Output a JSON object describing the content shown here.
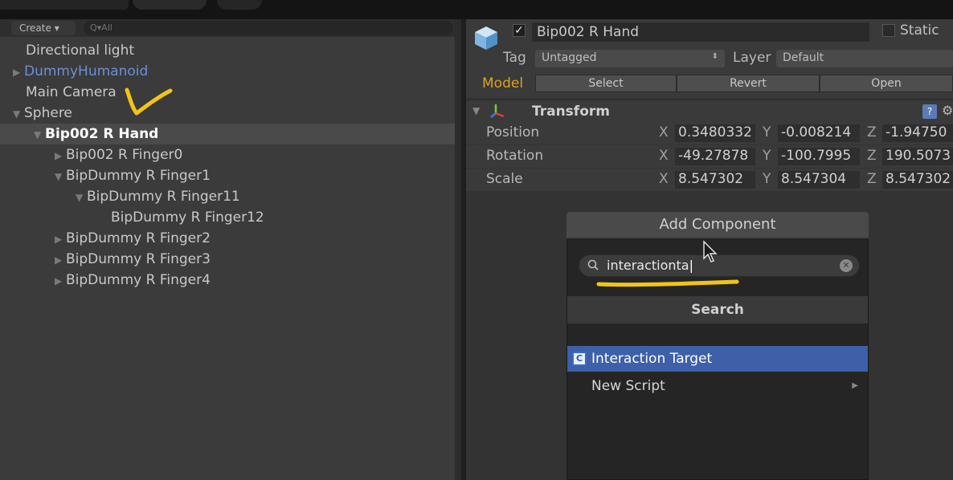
{
  "hierarchy": {
    "create_label": "Create ▾",
    "search_placeholder": "Q▾All",
    "items": [
      {
        "label": "Directional light"
      },
      {
        "label": "DummyHumanoid"
      },
      {
        "label": "Main Camera"
      },
      {
        "label": "Sphere"
      },
      {
        "label": "Bip002 R Hand"
      },
      {
        "label": "Bip002 R Finger0"
      },
      {
        "label": "BipDummy R Finger1"
      },
      {
        "label": "BipDummy R Finger11"
      },
      {
        "label": "BipDummy R Finger12"
      },
      {
        "label": "BipDummy R Finger2"
      },
      {
        "label": "BipDummy R Finger3"
      },
      {
        "label": "BipDummy R Finger4"
      }
    ]
  },
  "inspector": {
    "object_name": "Bip002 R Hand",
    "active_check": "✓",
    "static_label": "Static",
    "tag_label": "Tag",
    "tag_value": "Untagged",
    "layer_label": "Layer",
    "layer_value": "Default",
    "model_label": "Model",
    "model_buttons": {
      "select": "Select",
      "revert": "Revert",
      "open": "Open"
    },
    "transform": {
      "title": "Transform",
      "help": "?",
      "axis_x": "X",
      "axis_y": "Y",
      "axis_z": "Z",
      "position": {
        "label": "Position",
        "x": "0.3480332",
        "y": "-0.008214",
        "z": "-1.94750"
      },
      "rotation": {
        "label": "Rotation",
        "x": "-49.27878",
        "y": "-100.7995",
        "z": "190.5073"
      },
      "scale": {
        "label": "Scale",
        "x": "8.547302",
        "y": "8.547304",
        "z": "8.547302"
      }
    }
  },
  "add_component": {
    "button_label": "Add Component",
    "search_value": "interactionta",
    "search_header": "Search",
    "results": [
      {
        "label": "Interaction Target",
        "icon": "script-icon"
      },
      {
        "label": "New Script"
      }
    ]
  },
  "colors": {
    "annotation": "#f2c418",
    "selection": "#3d60a8",
    "model_label": "#e0a020",
    "prefab_blue": "#6b8fd6"
  }
}
